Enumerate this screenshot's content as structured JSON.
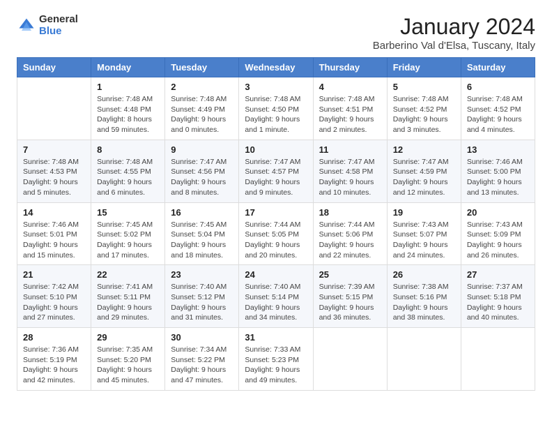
{
  "header": {
    "logo_general": "General",
    "logo_blue": "Blue",
    "title": "January 2024",
    "subtitle": "Barberino Val d'Elsa, Tuscany, Italy"
  },
  "weekdays": [
    "Sunday",
    "Monday",
    "Tuesday",
    "Wednesday",
    "Thursday",
    "Friday",
    "Saturday"
  ],
  "weeks": [
    [
      {
        "day": "",
        "sunrise": "",
        "sunset": "",
        "daylight": ""
      },
      {
        "day": "1",
        "sunrise": "Sunrise: 7:48 AM",
        "sunset": "Sunset: 4:48 PM",
        "daylight": "Daylight: 8 hours and 59 minutes."
      },
      {
        "day": "2",
        "sunrise": "Sunrise: 7:48 AM",
        "sunset": "Sunset: 4:49 PM",
        "daylight": "Daylight: 9 hours and 0 minutes."
      },
      {
        "day": "3",
        "sunrise": "Sunrise: 7:48 AM",
        "sunset": "Sunset: 4:50 PM",
        "daylight": "Daylight: 9 hours and 1 minute."
      },
      {
        "day": "4",
        "sunrise": "Sunrise: 7:48 AM",
        "sunset": "Sunset: 4:51 PM",
        "daylight": "Daylight: 9 hours and 2 minutes."
      },
      {
        "day": "5",
        "sunrise": "Sunrise: 7:48 AM",
        "sunset": "Sunset: 4:52 PM",
        "daylight": "Daylight: 9 hours and 3 minutes."
      },
      {
        "day": "6",
        "sunrise": "Sunrise: 7:48 AM",
        "sunset": "Sunset: 4:52 PM",
        "daylight": "Daylight: 9 hours and 4 minutes."
      }
    ],
    [
      {
        "day": "7",
        "sunrise": "Sunrise: 7:48 AM",
        "sunset": "Sunset: 4:53 PM",
        "daylight": "Daylight: 9 hours and 5 minutes."
      },
      {
        "day": "8",
        "sunrise": "Sunrise: 7:48 AM",
        "sunset": "Sunset: 4:55 PM",
        "daylight": "Daylight: 9 hours and 6 minutes."
      },
      {
        "day": "9",
        "sunrise": "Sunrise: 7:47 AM",
        "sunset": "Sunset: 4:56 PM",
        "daylight": "Daylight: 9 hours and 8 minutes."
      },
      {
        "day": "10",
        "sunrise": "Sunrise: 7:47 AM",
        "sunset": "Sunset: 4:57 PM",
        "daylight": "Daylight: 9 hours and 9 minutes."
      },
      {
        "day": "11",
        "sunrise": "Sunrise: 7:47 AM",
        "sunset": "Sunset: 4:58 PM",
        "daylight": "Daylight: 9 hours and 10 minutes."
      },
      {
        "day": "12",
        "sunrise": "Sunrise: 7:47 AM",
        "sunset": "Sunset: 4:59 PM",
        "daylight": "Daylight: 9 hours and 12 minutes."
      },
      {
        "day": "13",
        "sunrise": "Sunrise: 7:46 AM",
        "sunset": "Sunset: 5:00 PM",
        "daylight": "Daylight: 9 hours and 13 minutes."
      }
    ],
    [
      {
        "day": "14",
        "sunrise": "Sunrise: 7:46 AM",
        "sunset": "Sunset: 5:01 PM",
        "daylight": "Daylight: 9 hours and 15 minutes."
      },
      {
        "day": "15",
        "sunrise": "Sunrise: 7:45 AM",
        "sunset": "Sunset: 5:02 PM",
        "daylight": "Daylight: 9 hours and 17 minutes."
      },
      {
        "day": "16",
        "sunrise": "Sunrise: 7:45 AM",
        "sunset": "Sunset: 5:04 PM",
        "daylight": "Daylight: 9 hours and 18 minutes."
      },
      {
        "day": "17",
        "sunrise": "Sunrise: 7:44 AM",
        "sunset": "Sunset: 5:05 PM",
        "daylight": "Daylight: 9 hours and 20 minutes."
      },
      {
        "day": "18",
        "sunrise": "Sunrise: 7:44 AM",
        "sunset": "Sunset: 5:06 PM",
        "daylight": "Daylight: 9 hours and 22 minutes."
      },
      {
        "day": "19",
        "sunrise": "Sunrise: 7:43 AM",
        "sunset": "Sunset: 5:07 PM",
        "daylight": "Daylight: 9 hours and 24 minutes."
      },
      {
        "day": "20",
        "sunrise": "Sunrise: 7:43 AM",
        "sunset": "Sunset: 5:09 PM",
        "daylight": "Daylight: 9 hours and 26 minutes."
      }
    ],
    [
      {
        "day": "21",
        "sunrise": "Sunrise: 7:42 AM",
        "sunset": "Sunset: 5:10 PM",
        "daylight": "Daylight: 9 hours and 27 minutes."
      },
      {
        "day": "22",
        "sunrise": "Sunrise: 7:41 AM",
        "sunset": "Sunset: 5:11 PM",
        "daylight": "Daylight: 9 hours and 29 minutes."
      },
      {
        "day": "23",
        "sunrise": "Sunrise: 7:40 AM",
        "sunset": "Sunset: 5:12 PM",
        "daylight": "Daylight: 9 hours and 31 minutes."
      },
      {
        "day": "24",
        "sunrise": "Sunrise: 7:40 AM",
        "sunset": "Sunset: 5:14 PM",
        "daylight": "Daylight: 9 hours and 34 minutes."
      },
      {
        "day": "25",
        "sunrise": "Sunrise: 7:39 AM",
        "sunset": "Sunset: 5:15 PM",
        "daylight": "Daylight: 9 hours and 36 minutes."
      },
      {
        "day": "26",
        "sunrise": "Sunrise: 7:38 AM",
        "sunset": "Sunset: 5:16 PM",
        "daylight": "Daylight: 9 hours and 38 minutes."
      },
      {
        "day": "27",
        "sunrise": "Sunrise: 7:37 AM",
        "sunset": "Sunset: 5:18 PM",
        "daylight": "Daylight: 9 hours and 40 minutes."
      }
    ],
    [
      {
        "day": "28",
        "sunrise": "Sunrise: 7:36 AM",
        "sunset": "Sunset: 5:19 PM",
        "daylight": "Daylight: 9 hours and 42 minutes."
      },
      {
        "day": "29",
        "sunrise": "Sunrise: 7:35 AM",
        "sunset": "Sunset: 5:20 PM",
        "daylight": "Daylight: 9 hours and 45 minutes."
      },
      {
        "day": "30",
        "sunrise": "Sunrise: 7:34 AM",
        "sunset": "Sunset: 5:22 PM",
        "daylight": "Daylight: 9 hours and 47 minutes."
      },
      {
        "day": "31",
        "sunrise": "Sunrise: 7:33 AM",
        "sunset": "Sunset: 5:23 PM",
        "daylight": "Daylight: 9 hours and 49 minutes."
      },
      {
        "day": "",
        "sunrise": "",
        "sunset": "",
        "daylight": ""
      },
      {
        "day": "",
        "sunrise": "",
        "sunset": "",
        "daylight": ""
      },
      {
        "day": "",
        "sunrise": "",
        "sunset": "",
        "daylight": ""
      }
    ]
  ]
}
